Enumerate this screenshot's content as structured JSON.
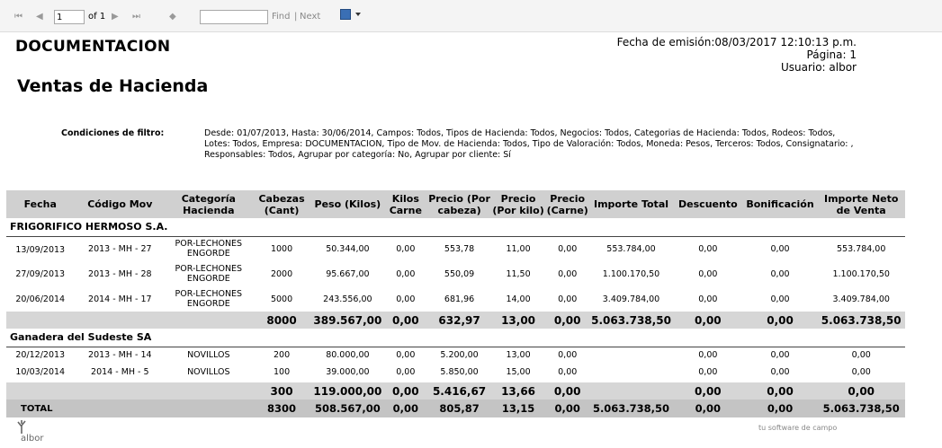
{
  "toolbar": {
    "page_value": "1",
    "of_label": "of 1",
    "find_label": "Find",
    "separator": "|",
    "next_label": "Next",
    "search_placeholder": ""
  },
  "header": {
    "company": "DOCUMENTACION",
    "report_title": "Ventas de Hacienda",
    "issue_date": "Fecha de emisión:08/03/2017 12:10:13 p.m.",
    "page": "Página: 1",
    "user": "Usuario: albor"
  },
  "filter": {
    "label": "Condiciones de filtro:",
    "text": "Desde: 01/07/2013, Hasta: 30/06/2014, Campos: Todos, Tipos de Hacienda: Todos, Negocios: Todos, Categorias de Hacienda: Todos, Rodeos: Todos, Lotes: Todos, Empresa: DOCUMENTACION, Tipo de Mov. de Hacienda: Todos, Tipo de Valoración: Todos, Moneda: Pesos, Terceros: Todos, Consignatario: , Responsables: Todos, Agrupar por categoría: No, Agrupar por cliente: Sí"
  },
  "columns": [
    "Fecha",
    "Código Mov",
    "Categoría Hacienda",
    "Cabezas (Cant)",
    "Peso (Kilos)",
    "Kilos Carne",
    "Precio (Por cabeza)",
    "Precio (Por kilo)",
    "Precio (Carne)",
    "Importe Total",
    "Descuento",
    "Bonificación",
    "Importe Neto de Venta"
  ],
  "groups": [
    {
      "name": "FRIGORIFICO HERMOSO S.A.",
      "rows": [
        [
          "13/09/2013",
          "2013 - MH - 27",
          "POR-LECHONES ENGORDE",
          "1000",
          "50.344,00",
          "0,00",
          "553,78",
          "11,00",
          "0,00",
          "553.784,00",
          "0,00",
          "0,00",
          "553.784,00"
        ],
        [
          "27/09/2013",
          "2013 - MH - 28",
          "POR-LECHONES ENGORDE",
          "2000",
          "95.667,00",
          "0,00",
          "550,09",
          "11,50",
          "0,00",
          "1.100.170,50",
          "0,00",
          "0,00",
          "1.100.170,50"
        ],
        [
          "20/06/2014",
          "2014 - MH - 17",
          "POR-LECHONES ENGORDE",
          "5000",
          "243.556,00",
          "0,00",
          "681,96",
          "14,00",
          "0,00",
          "3.409.784,00",
          "0,00",
          "0,00",
          "3.409.784,00"
        ]
      ],
      "subtotal": [
        "",
        "",
        "",
        "8000",
        "389.567,00",
        "0,00",
        "632,97",
        "13,00",
        "0,00",
        "5.063.738,50",
        "0,00",
        "0,00",
        "5.063.738,50"
      ]
    },
    {
      "name": "Ganadera del Sudeste SA",
      "rows": [
        [
          "20/12/2013",
          "2013 - MH - 14",
          "NOVILLOS",
          "200",
          "80.000,00",
          "0,00",
          "5.200,00",
          "13,00",
          "0,00",
          "",
          "0,00",
          "0,00",
          "0,00"
        ],
        [
          "10/03/2014",
          "2014 - MH - 5",
          "NOVILLOS",
          "100",
          "39.000,00",
          "0,00",
          "5.850,00",
          "15,00",
          "0,00",
          "",
          "0,00",
          "0,00",
          "0,00"
        ]
      ],
      "subtotal": [
        "",
        "",
        "",
        "300",
        "119.000,00",
        "0,00",
        "5.416,67",
        "13,66",
        "0,00",
        "",
        "0,00",
        "0,00",
        "0,00"
      ]
    }
  ],
  "total": [
    "TOTAL",
    "",
    "",
    "8300",
    "508.567,00",
    "0,00",
    "805,87",
    "13,15",
    "0,00",
    "5.063.738,50",
    "0,00",
    "0,00",
    "5.063.738,50"
  ],
  "footer": {
    "logo_text": "albor",
    "tagline": "tu software de campo"
  }
}
